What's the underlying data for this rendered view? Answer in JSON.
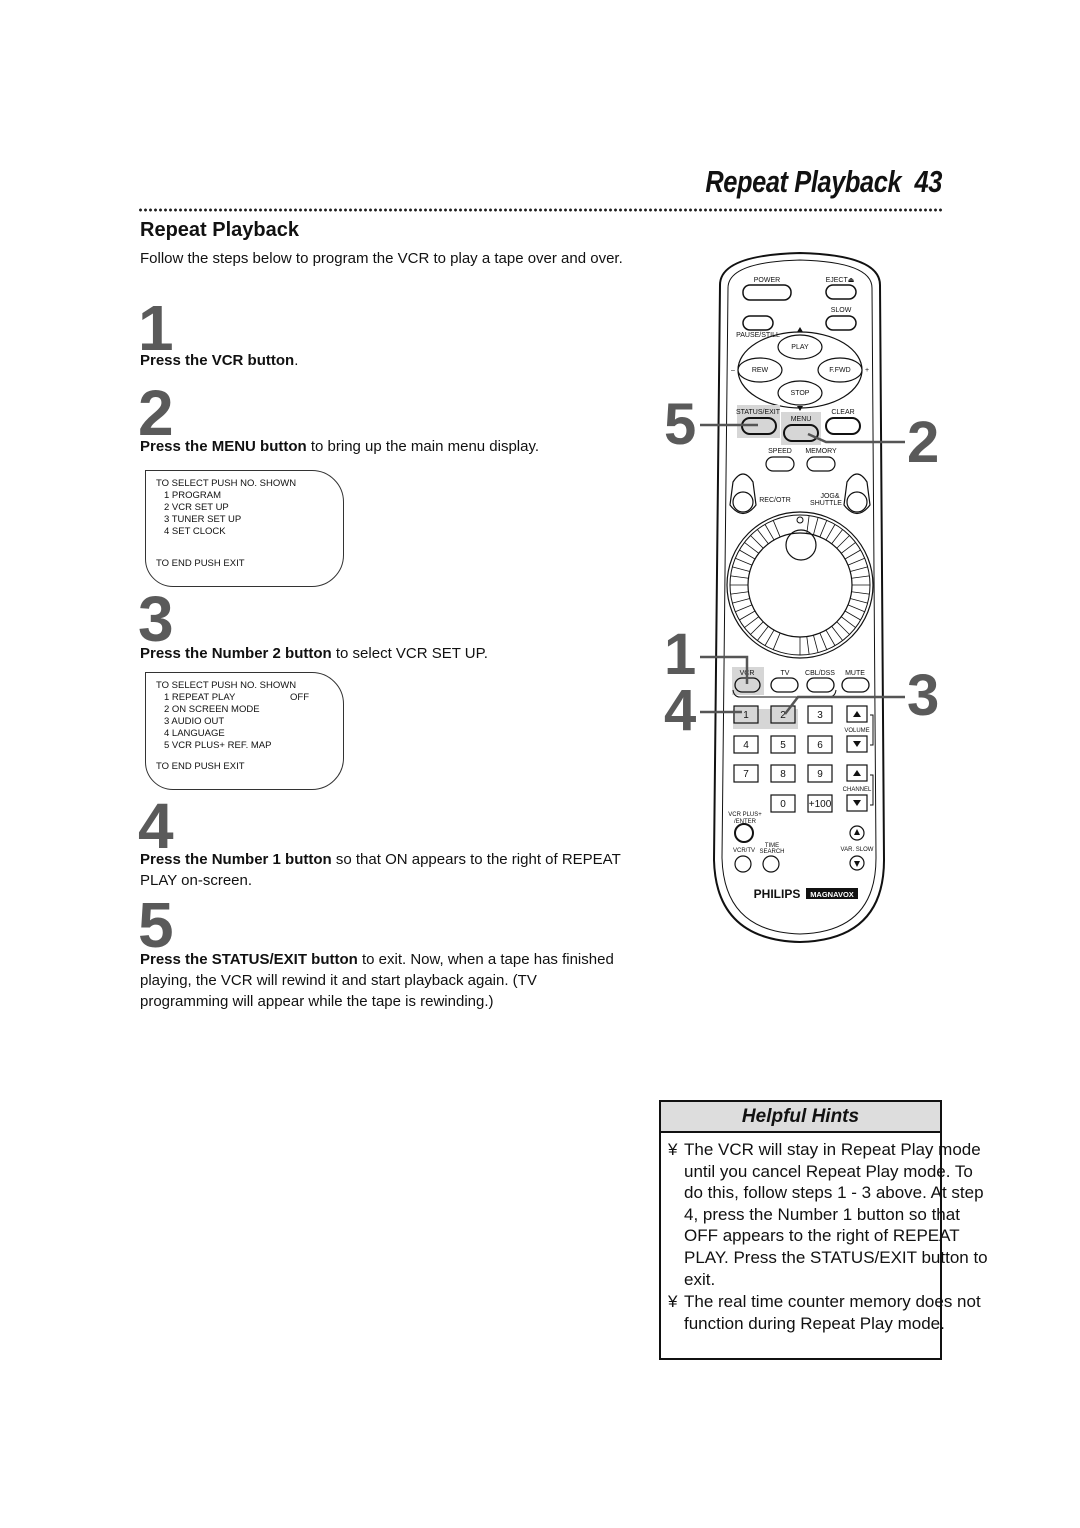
{
  "header": {
    "title": "Repeat Playback",
    "page_number": "43"
  },
  "section": {
    "title": "Repeat Playback",
    "intro": "Follow the steps below to program the VCR to play a tape over and over."
  },
  "steps": [
    {
      "number": "1",
      "bold": "Press the VCR button",
      "rest": "."
    },
    {
      "number": "2",
      "bold": "Press the MENU button",
      "rest": " to bring up the main menu display."
    },
    {
      "number": "3",
      "bold": "Press the Number 2 button",
      "rest": " to select VCR SET UP."
    },
    {
      "number": "4",
      "bold": "Press the Number 1 button",
      "rest": " so that ON appears to the right of REPEAT PLAY on-screen."
    },
    {
      "number": "5",
      "bold": "Press the STATUS/EXIT button",
      "rest": " to exit. Now, when a tape has finished playing, the VCR will rewind it and start playback again. (TV programming will appear while the tape is rewinding.)"
    }
  ],
  "main_menu": {
    "header": "TO SELECT PUSH NO. SHOWN",
    "items": [
      "1 PROGRAM",
      "2 VCR SET UP",
      "3 TUNER SET UP",
      "4 SET CLOCK"
    ],
    "footer": "TO END PUSH EXIT"
  },
  "vcr_setup_menu": {
    "header": "TO SELECT PUSH NO. SHOWN",
    "items": [
      {
        "label": "1 REPEAT PLAY",
        "value": "OFF"
      },
      {
        "label": "2 ON SCREEN MODE",
        "value": ""
      },
      {
        "label": "3 AUDIO OUT",
        "value": ""
      },
      {
        "label": "4 LANGUAGE",
        "value": ""
      },
      {
        "label": "5 VCR PLUS+ REF. MAP",
        "value": ""
      }
    ],
    "footer": "TO END PUSH EXIT"
  },
  "remote": {
    "power": "POWER",
    "eject": "EJECT⏏",
    "slow": "SLOW",
    "pause_still": "PAUSE/STILL",
    "play": "PLAY",
    "rew": "REW",
    "ffwd": "F.FWD",
    "stop": "STOP",
    "minus": "–",
    "plus": "+",
    "status_exit": "STATUS/EXIT",
    "menu": "MENU",
    "clear": "CLEAR",
    "speed": "SPEED",
    "memory": "MEMORY",
    "rec_otr": "REC/OTR",
    "jog1": "JOG&",
    "jog2": "SHUTTLE",
    "vcr": "VCR",
    "tv": "TV",
    "cbl_dss": "CBL/DSS",
    "mute": "MUTE",
    "keys": [
      "1",
      "2",
      "3",
      "4",
      "5",
      "6",
      "7",
      "8",
      "9",
      "0",
      "+100"
    ],
    "volume": "VOLUME",
    "channel": "CHANNEL",
    "vcr_plus1": "VCR PLUS+",
    "vcr_plus2": "/ENTER",
    "vcr_tv": "VCR/TV",
    "time1": "TIME",
    "time2": "SEARCH",
    "var_slow": "VAR. SLOW",
    "brand1": "PHILIPS",
    "brand2": "MAGNAVOX"
  },
  "callouts": {
    "c5": "5",
    "c2": "2",
    "c1": "1",
    "c4": "4",
    "c3": "3"
  },
  "hints": {
    "title": "Helpful Hints",
    "bullet": "¥",
    "items": [
      "The VCR will stay in Repeat Play mode until you cancel Repeat Play mode. To do this, follow steps 1 - 3 above. At step 4, press the Number 1 button so that OFF appears to the right of REPEAT PLAY. Press the STATUS/EXIT button to exit.",
      "The real time counter memory does not function during Repeat Play mode."
    ]
  }
}
